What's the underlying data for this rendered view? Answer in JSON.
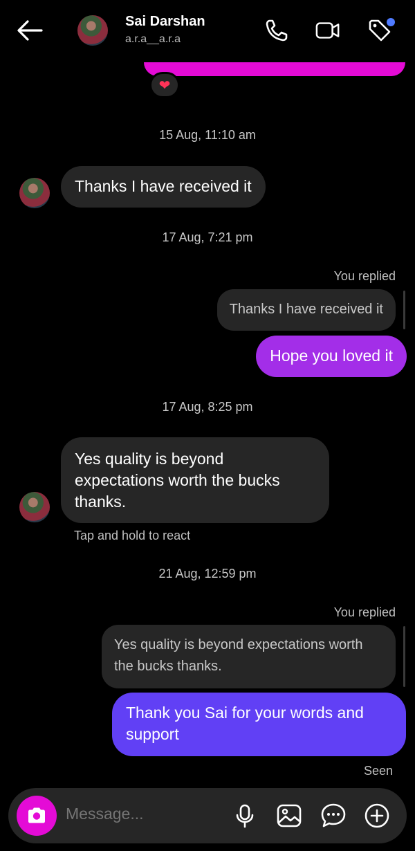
{
  "header": {
    "name": "Sai Darshan",
    "username": "a.r.a__a.r.a"
  },
  "reaction": "❤",
  "messages": {
    "ts1": "15 Aug, 11:10 am",
    "m1": "Thanks I have received it",
    "ts2": "17 Aug, 7:21 pm",
    "replied1": "You replied",
    "quote1": "Thanks I have received it",
    "m2": "Hope you loved it",
    "ts3": "17 Aug, 8:25 pm",
    "m3": "Yes quality is beyond expectations worth the bucks thanks.",
    "hint": "Tap and hold to react",
    "ts4": "21 Aug, 12:59 pm",
    "replied2": "You replied",
    "quote2": "Yes quality is beyond expectations worth the bucks thanks.",
    "m4": "Thank you Sai for your words and support",
    "seen": "Seen"
  },
  "composer": {
    "placeholder": "Message..."
  },
  "colors": {
    "magenta": "#e40bd6",
    "purple": "#a32ee8",
    "blue": "#6140f5",
    "bubble_dark": "#262626"
  }
}
